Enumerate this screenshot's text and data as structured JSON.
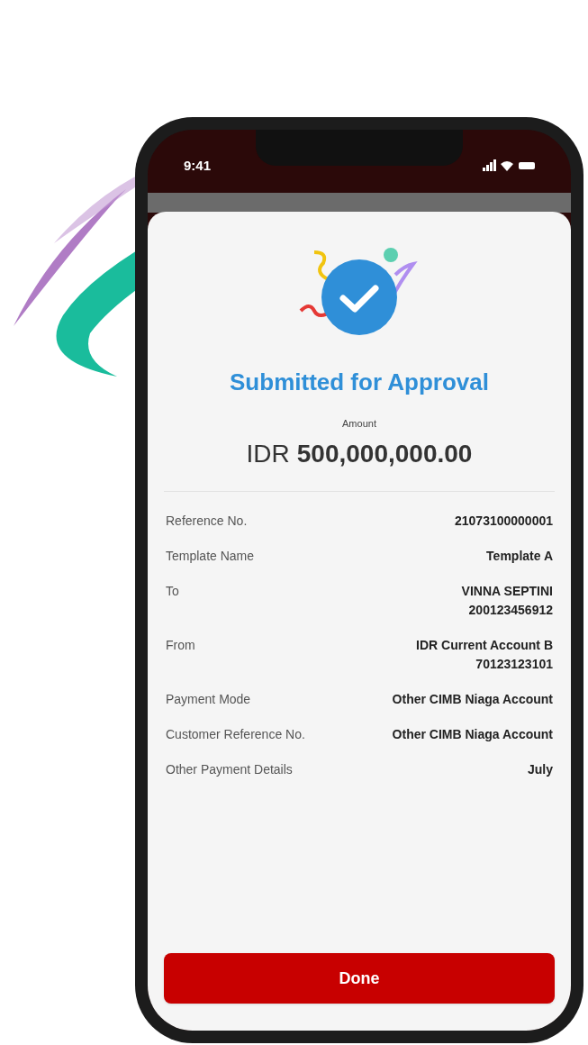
{
  "status_bar": {
    "time": "9:41"
  },
  "result": {
    "title": "Submitted for Approval",
    "amount_label": "Amount",
    "currency": "IDR",
    "amount": "500,000,000.00"
  },
  "details": [
    {
      "label": "Reference No.",
      "value": [
        "21073100000001"
      ]
    },
    {
      "label": "Template Name",
      "value": [
        "Template A"
      ]
    },
    {
      "label": "To",
      "value": [
        "VINNA SEPTINI",
        "200123456912"
      ]
    },
    {
      "label": "From",
      "value": [
        "IDR Current Account B",
        "70123123101"
      ]
    },
    {
      "label": "Payment Mode",
      "value": [
        "Other CIMB Niaga Account"
      ]
    },
    {
      "label": "Customer Reference No.",
      "value": [
        "Other CIMB Niaga Account"
      ]
    },
    {
      "label": "Other Payment Details",
      "value": [
        "July"
      ]
    }
  ],
  "done_button": "Done"
}
